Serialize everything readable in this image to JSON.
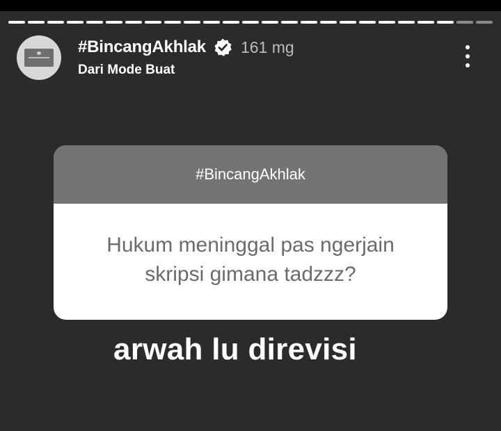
{
  "story": {
    "segments_total": 25,
    "segments_seen": 23
  },
  "header": {
    "username": "#BincangAkhlak",
    "time_ago": "161 mg",
    "subtitle": "Dari Mode Buat",
    "avatar_icon": "profile-logo-icon",
    "verified_icon": "verified-badge-icon",
    "more_icon": "more-vertical-icon"
  },
  "question_sticker": {
    "title": "#BincangAkhlak",
    "question": "Hukum meninggal pas ngerjain skripsi gimana tadzzz?"
  },
  "answer": {
    "text": "arwah lu direvisi"
  },
  "colors": {
    "background": "#2b2b2b",
    "sticker_header": "#737373",
    "question_text": "#6b6b6b",
    "seen_segment": "#ffffff",
    "unseen_segment": "#8a8a8a"
  }
}
